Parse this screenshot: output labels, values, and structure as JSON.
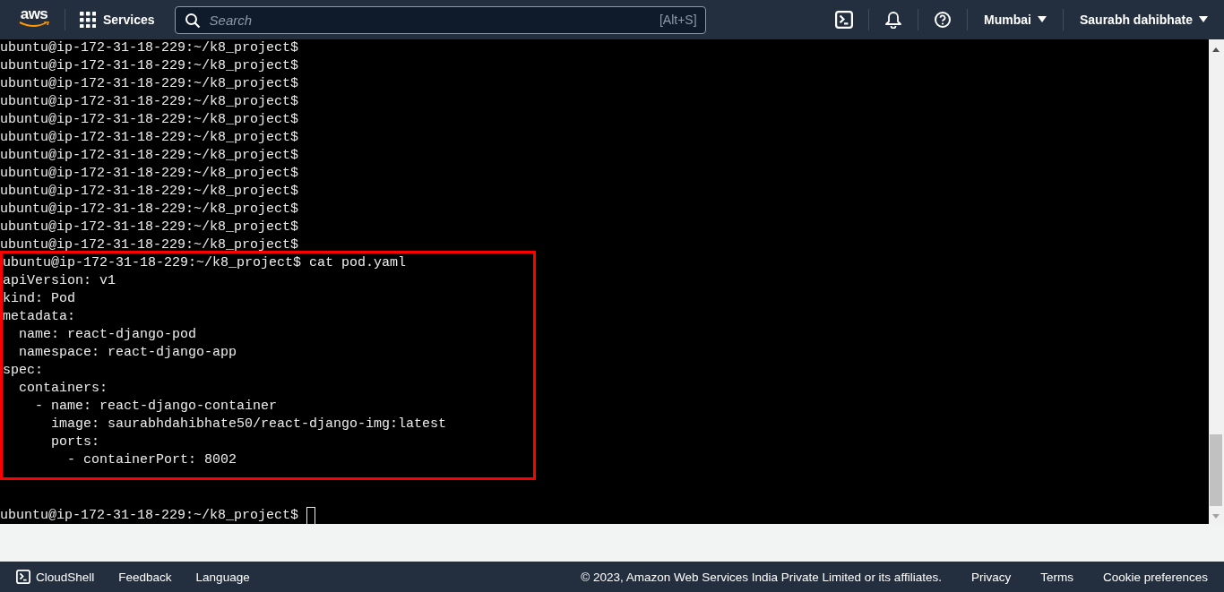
{
  "header": {
    "logo": "aws",
    "services": "Services",
    "search": {
      "placeholder": "Search",
      "shortcut": "[Alt+S]"
    },
    "region": "Mumbai",
    "account": "Saurabh dahibhate"
  },
  "terminal": {
    "history": [
      "ubuntu@ip-172-31-18-229:~/k8_project$",
      "ubuntu@ip-172-31-18-229:~/k8_project$",
      "ubuntu@ip-172-31-18-229:~/k8_project$",
      "ubuntu@ip-172-31-18-229:~/k8_project$",
      "ubuntu@ip-172-31-18-229:~/k8_project$",
      "ubuntu@ip-172-31-18-229:~/k8_project$",
      "ubuntu@ip-172-31-18-229:~/k8_project$",
      "ubuntu@ip-172-31-18-229:~/k8_project$",
      "ubuntu@ip-172-31-18-229:~/k8_project$",
      "ubuntu@ip-172-31-18-229:~/k8_project$",
      "ubuntu@ip-172-31-18-229:~/k8_project$",
      "ubuntu@ip-172-31-18-229:~/k8_project$"
    ],
    "highlighted_output": [
      "ubuntu@ip-172-31-18-229:~/k8_project$ cat pod.yaml",
      "apiVersion: v1",
      "kind: Pod",
      "metadata:",
      "  name: react-django-pod",
      "  namespace: react-django-app",
      "spec:",
      "  containers:",
      "    - name: react-django-container",
      "      image: saurabhdahibhate50/react-django-img:latest",
      "      ports:",
      "        - containerPort: 8002"
    ],
    "prompt": "ubuntu@ip-172-31-18-229:~/k8_project$"
  },
  "footer": {
    "left": [
      "CloudShell",
      "Feedback",
      "Language"
    ],
    "copyright": "© 2023, Amazon Web Services India Private Limited or its affiliates.",
    "links": [
      "Privacy",
      "Terms",
      "Cookie preferences"
    ]
  }
}
